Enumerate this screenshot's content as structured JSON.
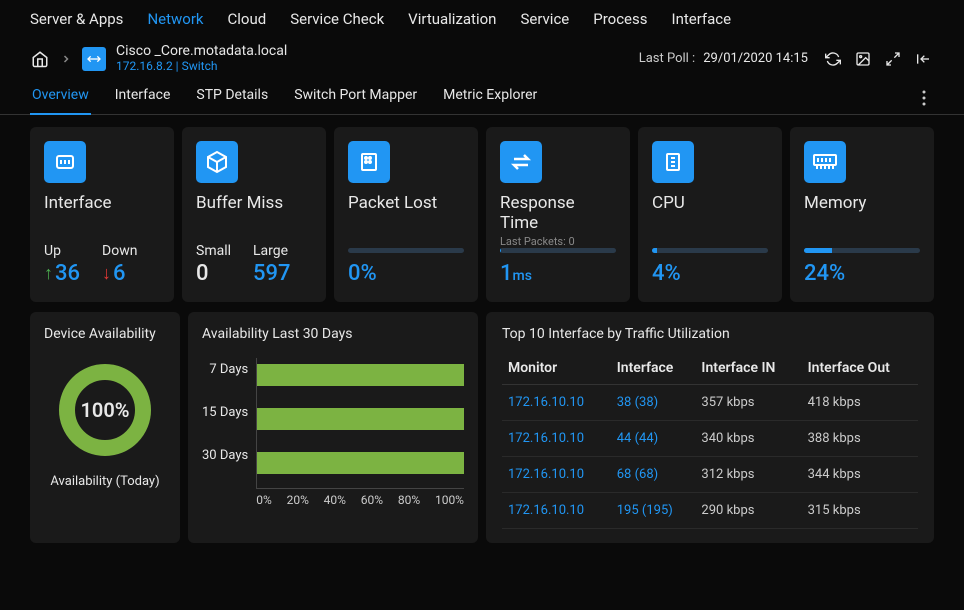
{
  "top_nav": {
    "items": [
      "Server & Apps",
      "Network",
      "Cloud",
      "Service Check",
      "Virtualization",
      "Service",
      "Process",
      "Interface"
    ],
    "active_index": 1
  },
  "breadcrumb": {
    "title": "Cisco _Core.motadata.local",
    "sub": "172.16.8.2 | Switch",
    "last_poll_label": "Last Poll :",
    "last_poll_value": "29/01/2020 14:15"
  },
  "sub_tabs": {
    "items": [
      "Overview",
      "Interface",
      "STP Details",
      "Switch Port Mapper",
      "Metric Explorer"
    ],
    "active_index": 0
  },
  "cards": {
    "interface": {
      "title": "Interface",
      "up_label": "Up",
      "up_value": "36",
      "down_label": "Down",
      "down_value": "6"
    },
    "buffer": {
      "title": "Buffer Miss",
      "small_label": "Small",
      "small_value": "0",
      "large_label": "Large",
      "large_value": "597"
    },
    "packet": {
      "title": "Packet Lost",
      "value": "0%",
      "bar_pct": 0
    },
    "response": {
      "title": "Response Time",
      "sub": "Last Packets: 0",
      "value": "1",
      "unit": "ms",
      "bar_pct": 1
    },
    "cpu": {
      "title": "CPU",
      "value": "4%",
      "bar_pct": 4
    },
    "memory": {
      "title": "Memory",
      "value": "24%",
      "bar_pct": 24
    }
  },
  "availability": {
    "title": "Device Availability",
    "donut_value": "100%",
    "donut_pct": 100,
    "caption": "Availability (Today)"
  },
  "chart_data": {
    "type": "bar",
    "title": "Availability Last 30 Days",
    "categories": [
      "7 Days",
      "15 Days",
      "30 Days"
    ],
    "values": [
      100,
      100,
      100
    ],
    "xlabel": "",
    "ylabel": "",
    "xlim": [
      0,
      100
    ],
    "x_ticks": [
      "0%",
      "20%",
      "40%",
      "60%",
      "80%",
      "100%"
    ]
  },
  "top_interfaces": {
    "title": "Top 10 Interface by Traffic Utilization",
    "columns": [
      "Monitor",
      "Interface",
      "Interface IN",
      "Interface Out"
    ],
    "rows": [
      {
        "monitor": "172.16.10.10",
        "iface": "38 (38)",
        "in": "357 kbps",
        "out": "418 kbps"
      },
      {
        "monitor": "172.16.10.10",
        "iface": "44 (44)",
        "in": "340 kbps",
        "out": "388 kbps"
      },
      {
        "monitor": "172.16.10.10",
        "iface": "68 (68)",
        "in": "312 kbps",
        "out": "344 kbps"
      },
      {
        "monitor": "172.16.10.10",
        "iface": "195 (195)",
        "in": "290 kbps",
        "out": "315 kbps"
      }
    ]
  }
}
